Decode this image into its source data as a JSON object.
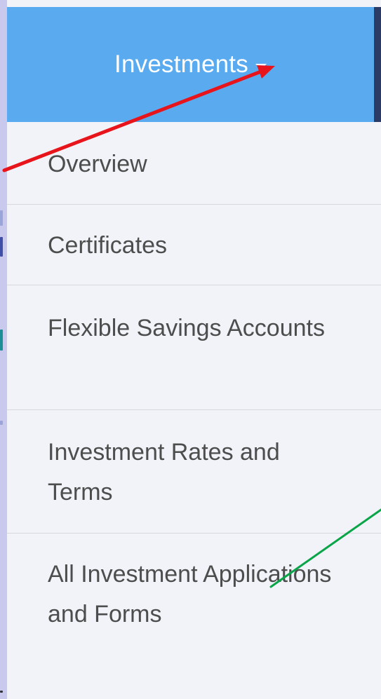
{
  "nav": {
    "title": "Investments",
    "caret_icon": "chevron-down-icon"
  },
  "menu": {
    "items": [
      {
        "label": "Overview"
      },
      {
        "label": "Certificates"
      },
      {
        "label": "Flexible Savings Accounts"
      },
      {
        "label": "Investment Rates and Terms"
      },
      {
        "label": "All Investment Applications and Forms"
      }
    ]
  },
  "colors": {
    "header_bg": "#5aaaf0",
    "menu_bg": "#f1f3f8",
    "text": "#4d4d4d",
    "annotation_red": "#e8141c",
    "annotation_green": "#0aa548"
  }
}
